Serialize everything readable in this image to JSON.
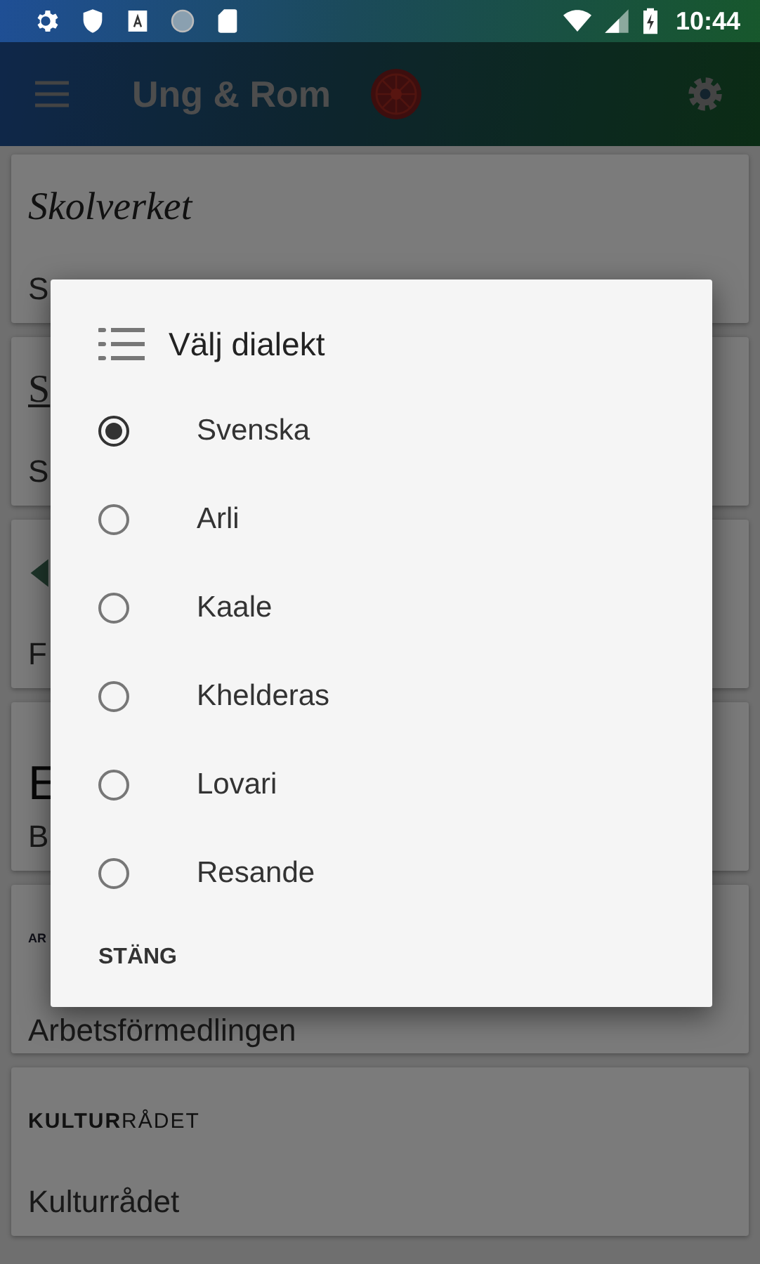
{
  "status_bar": {
    "time": "10:44"
  },
  "app_bar": {
    "title": "Ung & Rom"
  },
  "cards": [
    {
      "kind": "script",
      "logo": "Skolverket",
      "title": "S"
    },
    {
      "kind": "initial",
      "logo": "S",
      "title": "S"
    },
    {
      "kind": "icon",
      "title": "F"
    },
    {
      "kind": "large",
      "logo": "E",
      "title": "B"
    },
    {
      "kind": "tiny",
      "logo": "AR",
      "title": "Arbetsförmedlingen"
    },
    {
      "kind": "wordmark",
      "logo": "**KULTUR**RÅDET",
      "title": "Kulturrådet"
    }
  ],
  "dialog": {
    "title": "Välj dialekt",
    "options": [
      {
        "label": "Svenska",
        "selected": true
      },
      {
        "label": "Arli",
        "selected": false
      },
      {
        "label": "Kaale",
        "selected": false
      },
      {
        "label": "Khelderas",
        "selected": false
      },
      {
        "label": "Lovari",
        "selected": false
      },
      {
        "label": "Resande",
        "selected": false
      }
    ],
    "button": "STÄNG"
  }
}
